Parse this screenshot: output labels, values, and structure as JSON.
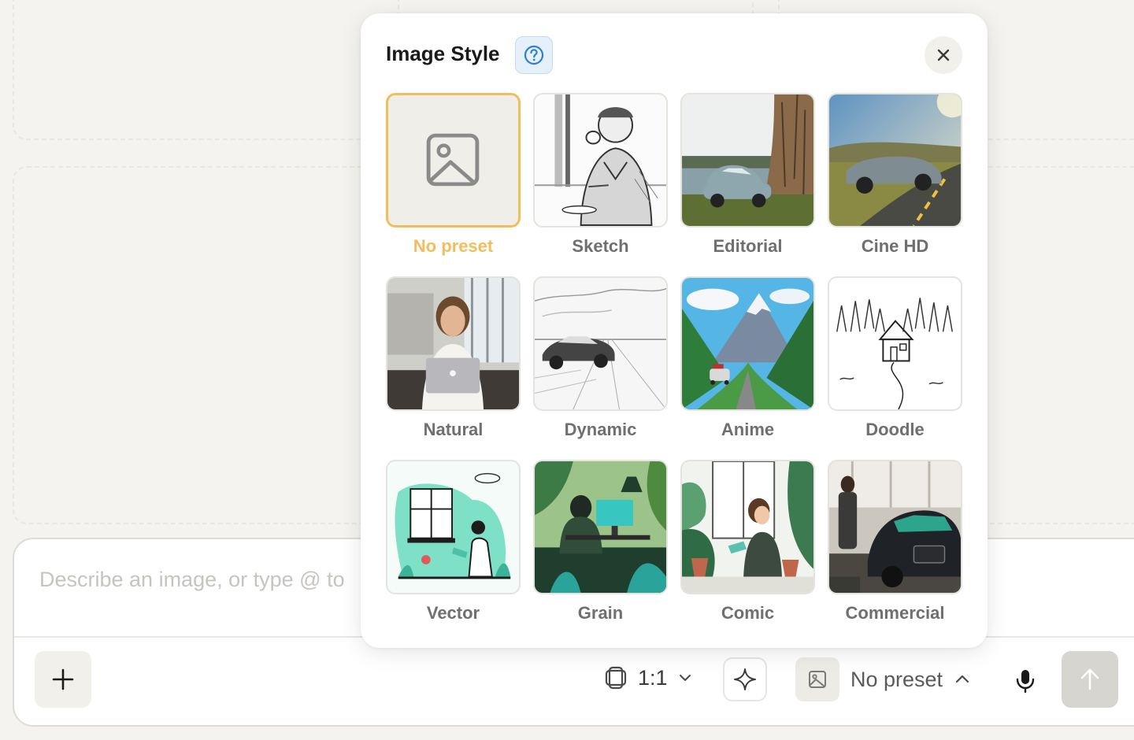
{
  "composer": {
    "placeholder": "Describe an image, or type @ to",
    "ratio_label": "1:1",
    "preset_label": "No preset"
  },
  "popup": {
    "title": "Image Style",
    "presets": [
      {
        "label": "No preset",
        "selected": true
      },
      {
        "label": "Sketch",
        "selected": false
      },
      {
        "label": "Editorial",
        "selected": false
      },
      {
        "label": "Cine HD",
        "selected": false
      },
      {
        "label": "Natural",
        "selected": false
      },
      {
        "label": "Dynamic",
        "selected": false
      },
      {
        "label": "Anime",
        "selected": false
      },
      {
        "label": "Doodle",
        "selected": false
      },
      {
        "label": "Vector",
        "selected": false
      },
      {
        "label": "Grain",
        "selected": false
      },
      {
        "label": "Comic",
        "selected": false
      },
      {
        "label": "Commercial",
        "selected": false
      }
    ]
  },
  "colors": {
    "accent": "#f2bd5d",
    "help_bg": "#e5f0fb",
    "help_icon": "#2f7fd1",
    "background": "#f4f3ef"
  },
  "icons": {
    "help": "question-circle-icon",
    "close": "close-icon",
    "plus": "plus-icon",
    "ratio": "aspect-ratio-icon",
    "chevron": "chevron-down-icon",
    "sparkle": "sparkle-icon",
    "preset": "image-icon",
    "mic": "microphone-icon",
    "send": "arrow-up-icon"
  }
}
